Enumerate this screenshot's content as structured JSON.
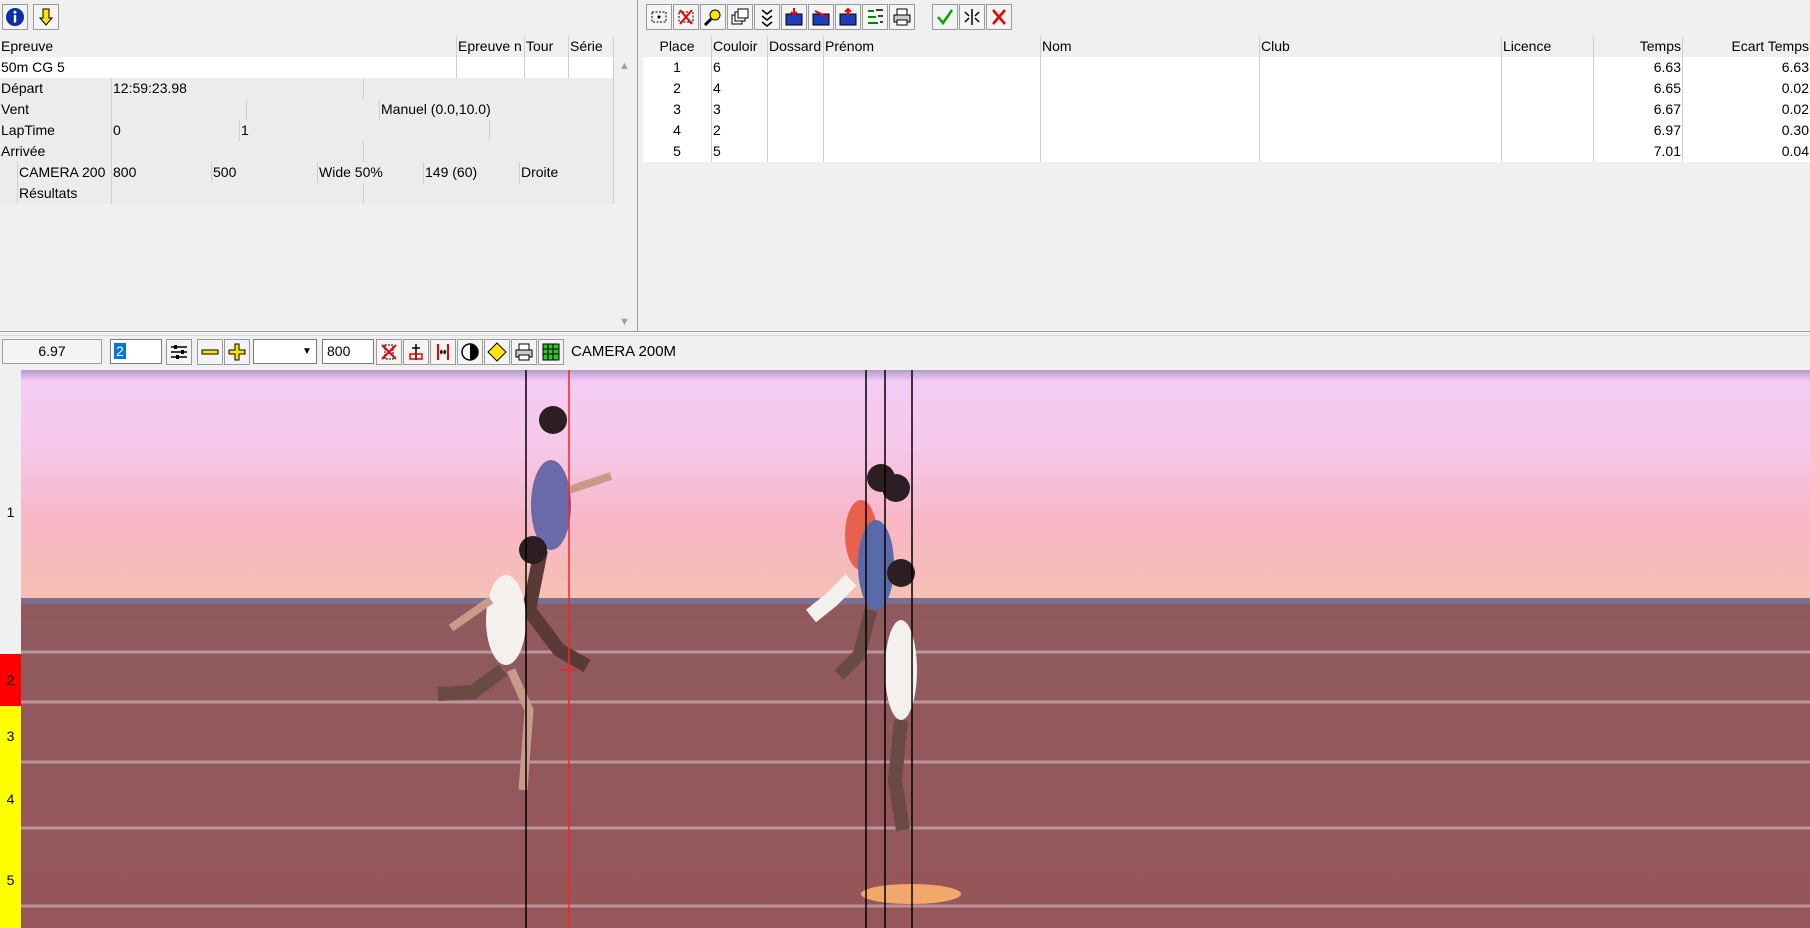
{
  "event_panel": {
    "columns": [
      "Epreuve",
      "Epreuve n",
      "Tour",
      "Série"
    ],
    "event_name": "50m CG 5",
    "rows": [
      {
        "label": "Départ",
        "values": [
          "12:59:23.98"
        ]
      },
      {
        "label": "Vent",
        "values": [
          "",
          "Manuel (0.0,10.0)"
        ]
      },
      {
        "label": "LapTime",
        "values": [
          "0",
          "1"
        ]
      },
      {
        "label": "Arrivée",
        "values": []
      }
    ],
    "camera_row": {
      "name": "CAMERA 200",
      "v1": "800",
      "v2": "500",
      "v3": "Wide 50%",
      "v4": "149  (60)",
      "v5": "Droite"
    },
    "results_row": {
      "label": "Résultats"
    }
  },
  "results": {
    "columns": {
      "place": "Place",
      "lane": "Couloir",
      "bib": "Dossard",
      "first_name": "Prénom",
      "last_name": "Nom",
      "club": "Club",
      "license": "Licence",
      "time": "Temps",
      "gap": "Ecart Temps"
    },
    "rows": [
      {
        "place": "1",
        "lane": "6",
        "time": "6.63",
        "gap": "6.63"
      },
      {
        "place": "2",
        "lane": "4",
        "time": "6.65",
        "gap": "0.02"
      },
      {
        "place": "3",
        "lane": "3",
        "time": "6.67",
        "gap": "0.02"
      },
      {
        "place": "4",
        "lane": "2",
        "time": "6.97",
        "gap": "0.30"
      },
      {
        "place": "5",
        "lane": "5",
        "time": "7.01",
        "gap": "0.04"
      }
    ]
  },
  "photo_toolbar": {
    "time_value": "6.97",
    "lane_value": "2",
    "zoom_value": "",
    "width_value": "800",
    "camera_name": "CAMERA 200M"
  },
  "lanes": [
    {
      "label": "1",
      "color": "#f0f0f0"
    },
    {
      "label": "2",
      "color": "#ff0000"
    },
    {
      "label": "3",
      "color": "#ffff00"
    },
    {
      "label": "4",
      "color": "#ffff00"
    },
    {
      "label": "5",
      "color": "#ffff00"
    }
  ],
  "icons": {
    "left_toolbar": [
      "info-icon",
      "download-arrow-icon"
    ],
    "right_toolbar": [
      "select-all-icon",
      "delete-icon",
      "search-icon",
      "windows-icon",
      "sort-icon",
      "import-icon",
      "edit-icon",
      "export-icon",
      "list-icon",
      "print-icon",
      "validate-icon",
      "split-icon",
      "cancel-icon"
    ],
    "photo_toolbar": [
      "settings-icon",
      "zoom-out-icon",
      "zoom-in-icon",
      "clear-lines-icon",
      "cursor-icon",
      "measure-icon",
      "contrast-icon",
      "brightness-icon",
      "print-icon",
      "grid-icon"
    ]
  }
}
